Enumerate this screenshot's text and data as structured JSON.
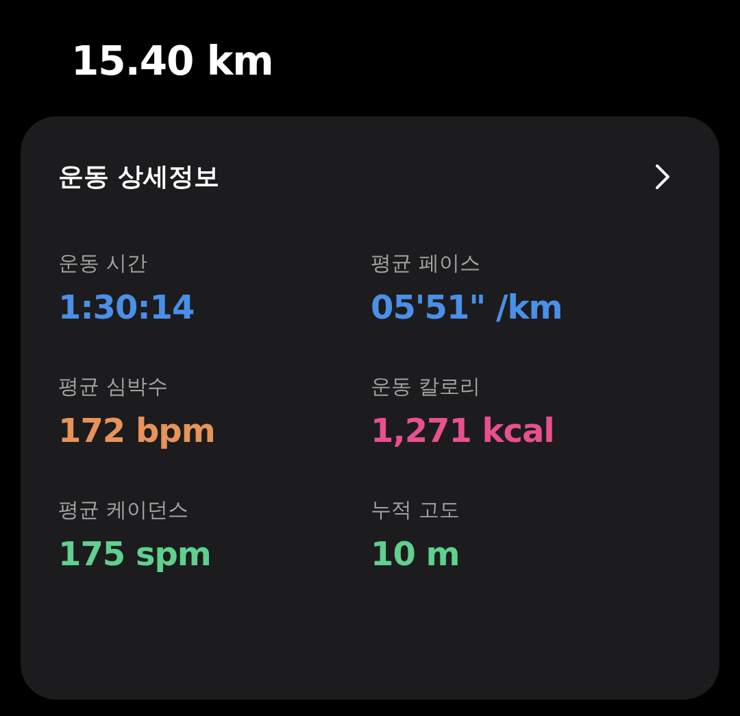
{
  "distance": "15.40 km",
  "card": {
    "title": "운동 상세정보",
    "stats": [
      {
        "label": "운동 시간",
        "value": "1:30:14",
        "color": "#4a8fe8"
      },
      {
        "label": "평균 페이스",
        "value": "05'51\" /km",
        "color": "#4a8fe8"
      },
      {
        "label": "평균 심박수",
        "value": "172 bpm",
        "color": "#e8935a"
      },
      {
        "label": "운동 칼로리",
        "value": "1,271 kcal",
        "color": "#e8508f"
      },
      {
        "label": "평균 케이던스",
        "value": "175 spm",
        "color": "#5fd08e"
      },
      {
        "label": "누적 고도",
        "value": "10 m",
        "color": "#5fd08e"
      }
    ]
  }
}
